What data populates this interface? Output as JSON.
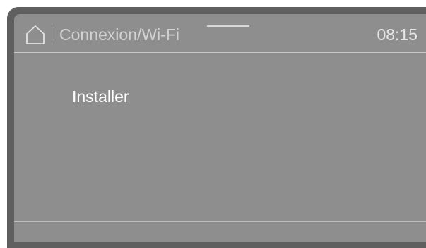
{
  "header": {
    "home_icon": "home-icon",
    "title": "Connexion/Wi-Fi",
    "time": "08:15"
  },
  "menu": {
    "items": [
      {
        "label": "Installer"
      }
    ]
  },
  "colors": {
    "bezel": "#5f5f5f",
    "screen": "#8e8e8e",
    "title_text": "#d2d2d2",
    "menu_text": "#ffffff",
    "divider": "#c8c8c8"
  }
}
